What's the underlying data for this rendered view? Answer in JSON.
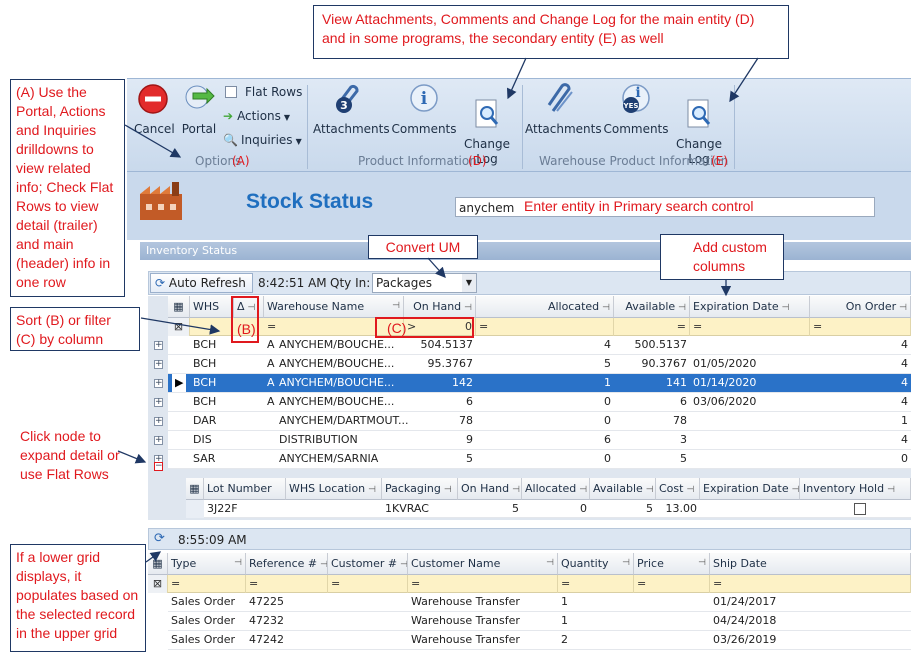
{
  "ribbon": {
    "cancel": "Cancel",
    "portal": "Portal",
    "flat_rows": "Flat Rows",
    "actions": "Actions",
    "inquiries": "Inquiries",
    "options_group": "Options",
    "product_attachments": "Attachments",
    "product_comments": "Comments",
    "product_change_log": "Change\nLog",
    "product_group": "Product Information",
    "wh_attachments": "Attachments",
    "wh_comments": "Comments",
    "wh_change_log": "Change\nLog",
    "wh_group": "Warehouse Product Information",
    "badge_attachments": "3",
    "badge_comments": "YES"
  },
  "page": {
    "title": "Stock Status",
    "search_value": "anychem",
    "section": "Inventory Status"
  },
  "toolbar": {
    "auto_refresh": "Auto Refresh",
    "time": "8:42:51 AM",
    "qty_in_label": "Qty In:",
    "qty_in_value": "Packages"
  },
  "upper_grid": {
    "columns": [
      "WHS",
      "Warehouse Name",
      "On Hand",
      "Allocated",
      "Available",
      "Expiration Date",
      "On Order"
    ],
    "sort_symbol": "Δ",
    "filter": {
      "eq": "=",
      "op": ">",
      "value": "0"
    },
    "rows": [
      {
        "whs": "BCH",
        "flag": "A",
        "name": "ANYCHEM/BOUCHE...",
        "onhand": "504.5137",
        "allocated": "4",
        "available": "500.5137",
        "exp": "",
        "onorder": "4"
      },
      {
        "whs": "BCH",
        "flag": "A",
        "name": "ANYCHEM/BOUCHE...",
        "onhand": "95.3767",
        "allocated": "5",
        "available": "90.3767",
        "exp": "01/05/2020",
        "onorder": "4"
      },
      {
        "whs": "BCH",
        "flag": "A",
        "name": "ANYCHEM/BOUCHE...",
        "onhand": "142",
        "allocated": "1",
        "available": "141",
        "exp": "01/14/2020",
        "onorder": "4"
      },
      {
        "whs": "BCH",
        "flag": "A",
        "name": "ANYCHEM/BOUCHE...",
        "onhand": "6",
        "allocated": "0",
        "available": "6",
        "exp": "03/06/2020",
        "onorder": "4"
      },
      {
        "whs": "DAR",
        "flag": "",
        "name": "ANYCHEM/DARTMOUT...",
        "onhand": "78",
        "allocated": "0",
        "available": "78",
        "exp": "",
        "onorder": "1"
      },
      {
        "whs": "DIS",
        "flag": "",
        "name": "DISTRIBUTION",
        "onhand": "9",
        "allocated": "6",
        "available": "3",
        "exp": "",
        "onorder": "4"
      },
      {
        "whs": "SAR",
        "flag": "",
        "name": "ANYCHEM/SARNIA",
        "onhand": "5",
        "allocated": "0",
        "available": "5",
        "exp": "",
        "onorder": "0"
      }
    ]
  },
  "detail_grid": {
    "columns": [
      "Lot Number",
      "WHS Location",
      "Packaging",
      "On Hand",
      "Allocated",
      "Available",
      "Cost",
      "Expiration Date",
      "Inventory Hold"
    ],
    "row": {
      "lot": "3J22F",
      "loc": "",
      "pack": "1KVRAC",
      "onhand": "5",
      "allocated": "0",
      "available": "5",
      "cost": "13.00",
      "exp": ""
    }
  },
  "lower": {
    "time": "8:55:09 AM",
    "columns": [
      "Type",
      "Reference #",
      "Customer #",
      "Customer Name",
      "Quantity",
      "Price",
      "Ship Date"
    ],
    "rows": [
      {
        "type": "Sales Order",
        "ref": "47225",
        "cust": "",
        "name": "Warehouse Transfer",
        "qty": "1",
        "price": "",
        "ship": "01/24/2017"
      },
      {
        "type": "Sales Order",
        "ref": "47232",
        "cust": "",
        "name": "Warehouse Transfer",
        "qty": "1",
        "price": "",
        "ship": "04/24/2018"
      },
      {
        "type": "Sales Order",
        "ref": "47242",
        "cust": "",
        "name": "Warehouse Transfer",
        "qty": "2",
        "price": "",
        "ship": "03/26/2019"
      }
    ]
  },
  "annotations": {
    "top": "View Attachments, Comments and Change Log for the main entity (D) and in some programs, the secondary entity (E) as well",
    "portal": "(A) Use the Portal, Actions and Inquiries drilldowns to view related info; Check Flat Rows to view detail (trailer) and main (header) info in one row",
    "sort": "Sort (B) or filter (C) by column",
    "node": "Click node to expand detail or use Flat Rows",
    "lower": "If a lower grid displays, it populates based on the selected record in the upper grid",
    "convert": "Convert UM",
    "custom": "Add custom columns",
    "search": "Enter entity in Primary search control",
    "label_a": "(A)",
    "label_d": "(D)",
    "label_e": "(E)",
    "label_b": "(B)",
    "label_c": "(C)"
  },
  "colors": {
    "accent": "#2a72c8",
    "annotation": "#e0191e",
    "title": "#1f6fbf"
  }
}
